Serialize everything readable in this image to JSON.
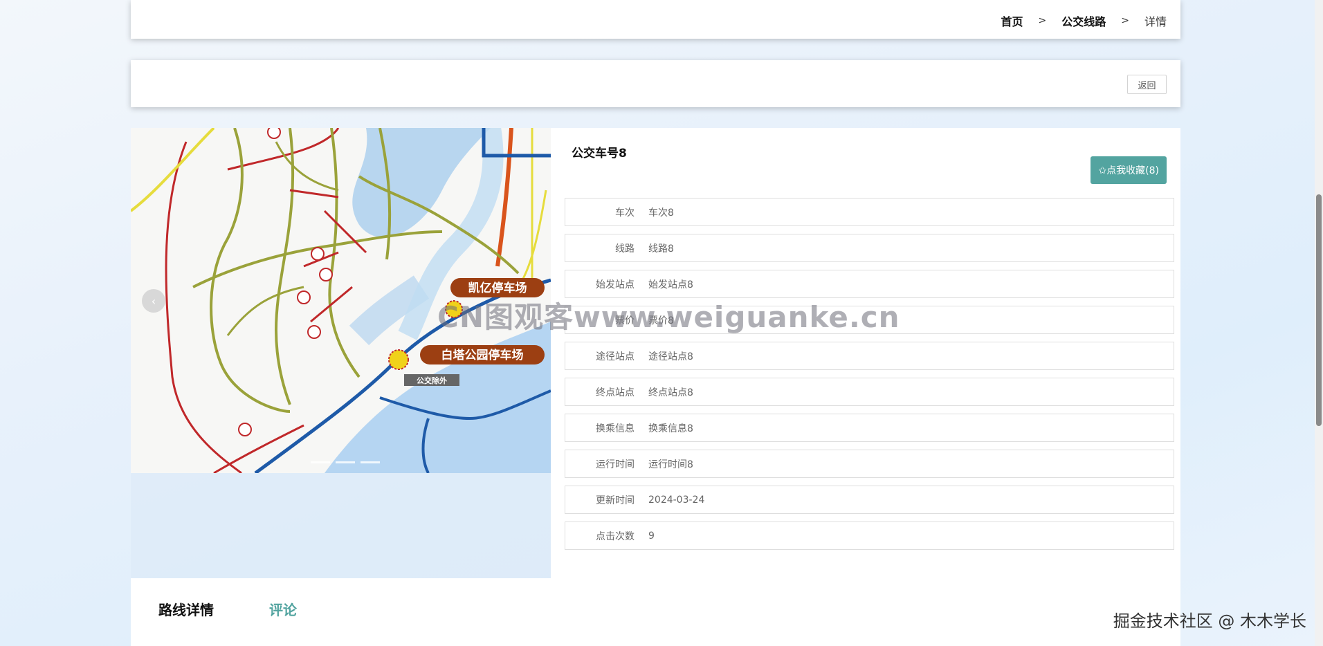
{
  "breadcrumb": {
    "home": "首页",
    "sep1": ">",
    "routes": "公交线路",
    "sep2": ">",
    "current": "详情"
  },
  "actions": {
    "back": "返回"
  },
  "detail": {
    "title": "公交车号8",
    "favorite_label": "✩点我收藏(8)",
    "fields": [
      {
        "label": "车次",
        "value": "车次8"
      },
      {
        "label": "线路",
        "value": "线路8"
      },
      {
        "label": "始发站点",
        "value": "始发站点8"
      },
      {
        "label": "票价",
        "value": "票价8"
      },
      {
        "label": "途径站点",
        "value": "途径站点8"
      },
      {
        "label": "终点站点",
        "value": "终点站点8"
      },
      {
        "label": "换乘信息",
        "value": "换乘信息8"
      },
      {
        "label": "运行时间",
        "value": "运行时间8"
      },
      {
        "label": "更新时间",
        "value": "2024-03-24"
      },
      {
        "label": "点击次数",
        "value": "9"
      }
    ]
  },
  "map": {
    "label1": "凯亿停车场",
    "label2": "白塔公园停车场",
    "label3": "公交除外"
  },
  "tabs": {
    "details": "路线详情",
    "comments": "评论"
  },
  "overlay": {
    "watermark": "CN图观客www.weiguanke.cn",
    "credit": "掘金技术社区 @ 木木学长"
  },
  "colors": {
    "accent": "#53a4a0"
  }
}
